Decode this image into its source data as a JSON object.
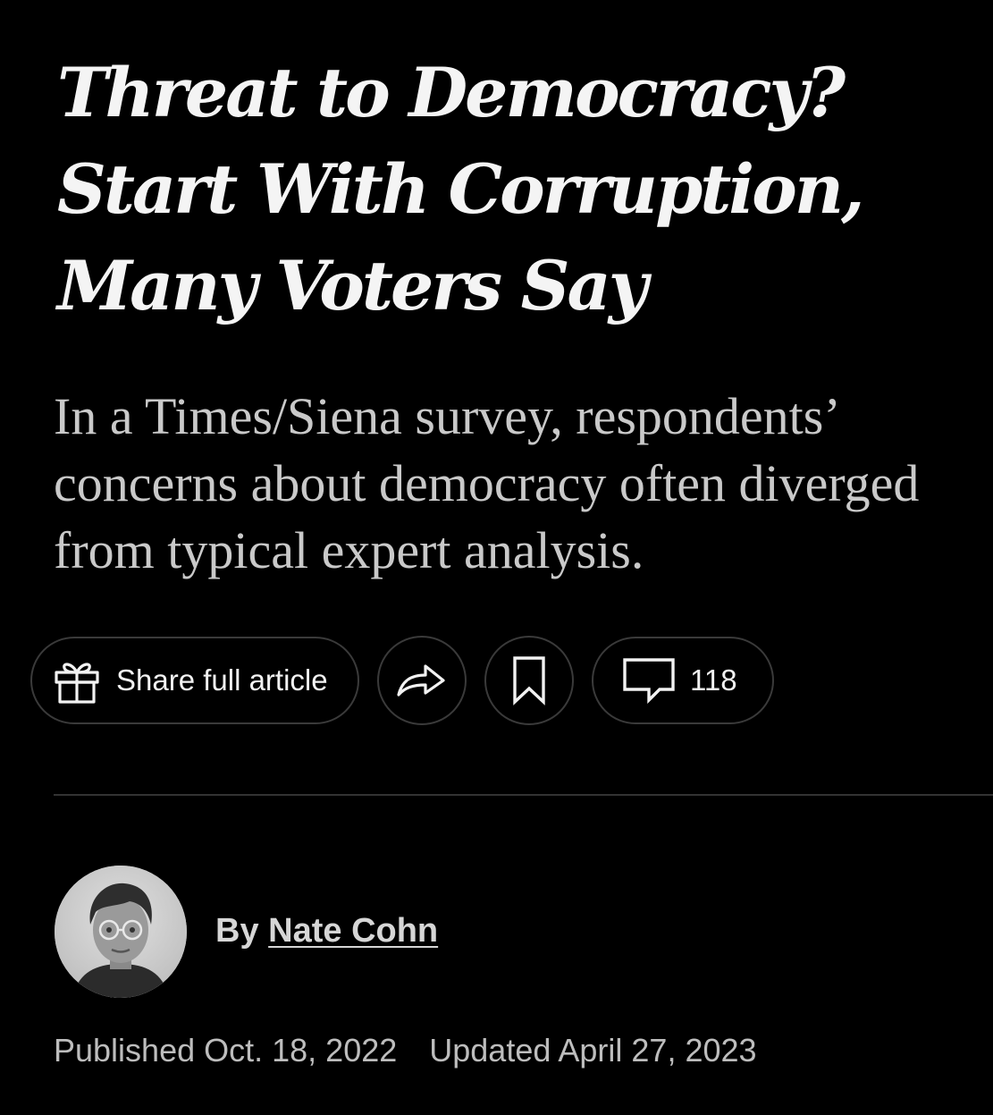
{
  "article": {
    "headline": "Threat to Democracy? Start With Corruption, Many Voters Say",
    "summary": "In a Times/Siena survey, respondents’ concerns about democracy often diverged from typical expert analysis."
  },
  "actions": {
    "share_full_label": "Share full article",
    "share_full_icon": "gift-icon",
    "share_icon": "share-arrow-icon",
    "save_icon": "bookmark-icon",
    "comments_icon": "comment-bubble-icon",
    "comments_count": "118"
  },
  "byline": {
    "prefix": "By",
    "author": "Nate Cohn"
  },
  "dates": {
    "published": "Published Oct. 18, 2022",
    "updated": "Updated April 27, 2023"
  },
  "colors": {
    "background": "#000000",
    "headline": "#f4f4f4",
    "summary": "#c9c9c9",
    "border": "#3a3a3a"
  }
}
